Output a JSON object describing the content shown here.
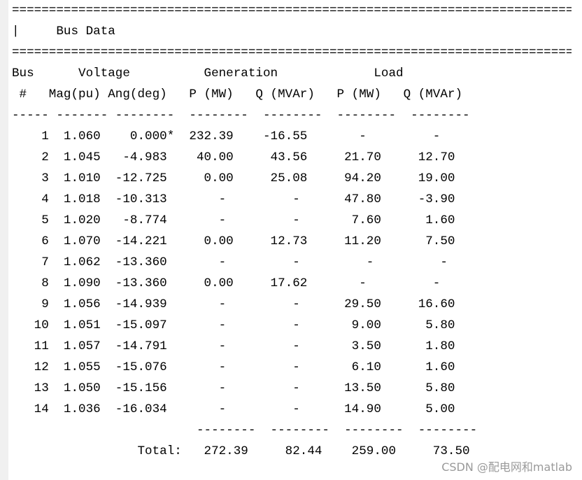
{
  "report": {
    "rule_line": "================================================================================",
    "title_line": "|     Bus Data                                                                 |",
    "header_line_1": "Bus      Voltage          Generation             Load        ",
    "header_line_2": " #   Mag(pu) Ang(deg)   P (MW)   Q (MVAr)   P (MW)   Q (MVAr)",
    "dash_line": "----- ------- --------  --------  --------  --------  --------",
    "rows": [
      "    1  1.060    0.000*  232.39    -16.55       -         -    ",
      "    2  1.045   -4.983    40.00     43.56     21.70     12.70  ",
      "    3  1.010  -12.725     0.00     25.08     94.20     19.00  ",
      "    4  1.018  -10.313       -         -      47.80     -3.90  ",
      "    5  1.020   -8.774       -         -       7.60      1.60  ",
      "    6  1.070  -14.221     0.00     12.73     11.20      7.50  ",
      "    7  1.062  -13.360       -         -         -         -    ",
      "    8  1.090  -13.360     0.00     17.62       -         -    ",
      "    9  1.056  -14.939       -         -      29.50     16.60  ",
      "   10  1.051  -15.097       -         -       9.00      5.80  ",
      "   11  1.057  -14.791       -         -       3.50      1.80  ",
      "   12  1.055  -15.076       -         -       6.10      1.60  ",
      "   13  1.050  -15.156       -         -      13.50      5.80  ",
      "   14  1.036  -16.034       -         -      14.90      5.00  "
    ],
    "total_dash_line": "                         --------  --------  --------  --------",
    "total_line": "                 Total:   272.39     82.44    259.00     73.50"
  },
  "watermark": "CSDN @配电网和matlab"
}
